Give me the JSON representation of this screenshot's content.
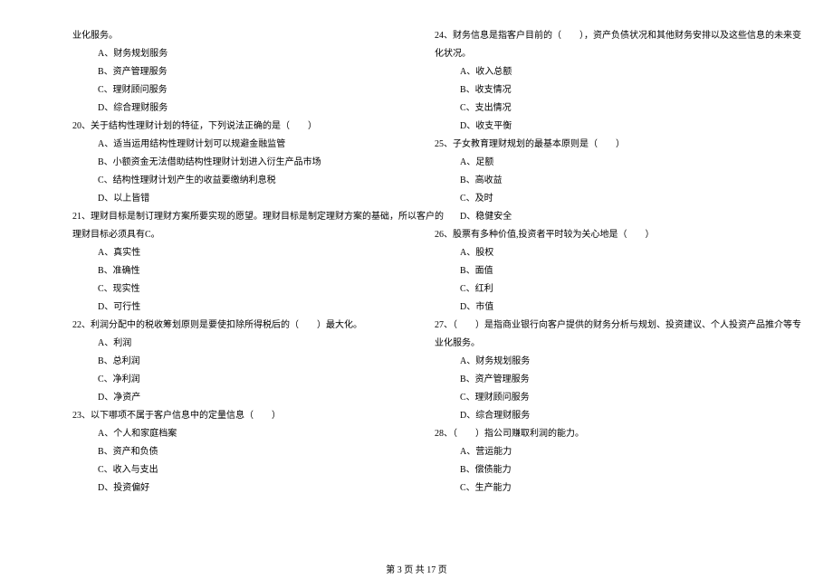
{
  "left": {
    "lines": [
      {
        "cls": "indent-0",
        "text": "业化服务。"
      },
      {
        "cls": "indent-1",
        "text": "A、财务规划服务"
      },
      {
        "cls": "indent-1",
        "text": "B、资产管理服务"
      },
      {
        "cls": "indent-1",
        "text": "C、理财顾问服务"
      },
      {
        "cls": "indent-1",
        "text": "D、综合理财服务"
      },
      {
        "cls": "indent-0",
        "text": "20、关于结构性理财计划的特征，下列说法正确的是（　　）"
      },
      {
        "cls": "indent-1",
        "text": "A、适当运用结构性理财计划可以规避金融监管"
      },
      {
        "cls": "indent-1",
        "text": "B、小额资金无法借助结构性理财计划进入衍生产品市场"
      },
      {
        "cls": "indent-1",
        "text": "C、结构性理财计划产生的收益要缴纳利息税"
      },
      {
        "cls": "indent-1",
        "text": "D、以上皆错"
      },
      {
        "cls": "indent-0",
        "text": "21、理财目标是制订理财方案所要实现的愿望。理财目标是制定理财方案的基础，所以客户的"
      },
      {
        "cls": "indent-0",
        "text": "理财目标必须具有C。"
      },
      {
        "cls": "indent-1",
        "text": "A、真实性"
      },
      {
        "cls": "indent-1",
        "text": "B、准确性"
      },
      {
        "cls": "indent-1",
        "text": "C、现实性"
      },
      {
        "cls": "indent-1",
        "text": "D、可行性"
      },
      {
        "cls": "indent-0",
        "text": "22、利润分配中的税收筹划原则是要使扣除所得税后的（　　）最大化。"
      },
      {
        "cls": "indent-1",
        "text": "A、利润"
      },
      {
        "cls": "indent-1",
        "text": "B、总利润"
      },
      {
        "cls": "indent-1",
        "text": "C、净利润"
      },
      {
        "cls": "indent-1",
        "text": "D、净资产"
      },
      {
        "cls": "indent-0",
        "text": "23、以下哪项不属于客户信息中的定量信息（　　）"
      },
      {
        "cls": "indent-1",
        "text": "A、个人和家庭档案"
      },
      {
        "cls": "indent-1",
        "text": "B、资产和负债"
      },
      {
        "cls": "indent-1",
        "text": "C、收入与支出"
      },
      {
        "cls": "indent-1",
        "text": "D、投资偏好"
      }
    ]
  },
  "right": {
    "lines": [
      {
        "cls": "indent-0",
        "text": "24、财务信息是指客户目前的（　　），资产负债状况和其他财务安排以及这些信息的未来变"
      },
      {
        "cls": "indent-0",
        "text": "化状况。"
      },
      {
        "cls": "indent-1",
        "text": "A、收入总额"
      },
      {
        "cls": "indent-1",
        "text": "B、收支情况"
      },
      {
        "cls": "indent-1",
        "text": "C、支出情况"
      },
      {
        "cls": "indent-1",
        "text": "D、收支平衡"
      },
      {
        "cls": "indent-0",
        "text": "25、子女教育理财规划的最基本原则是（　　）"
      },
      {
        "cls": "indent-1",
        "text": "A、足额"
      },
      {
        "cls": "indent-1",
        "text": "B、高收益"
      },
      {
        "cls": "indent-1",
        "text": "C、及时"
      },
      {
        "cls": "indent-1",
        "text": "D、稳健安全"
      },
      {
        "cls": "indent-0",
        "text": "26、股票有多种价值,投资者平时较为关心地是（　　）"
      },
      {
        "cls": "indent-1",
        "text": "A、股权"
      },
      {
        "cls": "indent-1",
        "text": "B、面值"
      },
      {
        "cls": "indent-1",
        "text": "C、红利"
      },
      {
        "cls": "indent-1",
        "text": "D、市值"
      },
      {
        "cls": "indent-0",
        "text": "27、（　　）是指商业银行向客户提供的财务分析与规划、投资建议、个人投资产品推介等专"
      },
      {
        "cls": "indent-0",
        "text": "业化服务。"
      },
      {
        "cls": "indent-1",
        "text": "A、财务规划服务"
      },
      {
        "cls": "indent-1",
        "text": "B、资产管理服务"
      },
      {
        "cls": "indent-1",
        "text": "C、理财顾问服务"
      },
      {
        "cls": "indent-1",
        "text": "D、综合理财服务"
      },
      {
        "cls": "indent-0",
        "text": "28、（　　）指公司赚取利润的能力。"
      },
      {
        "cls": "indent-1",
        "text": "A、营运能力"
      },
      {
        "cls": "indent-1",
        "text": "B、偿债能力"
      },
      {
        "cls": "indent-1",
        "text": "C、生产能力"
      }
    ]
  },
  "footer": "第 3 页 共 17 页"
}
